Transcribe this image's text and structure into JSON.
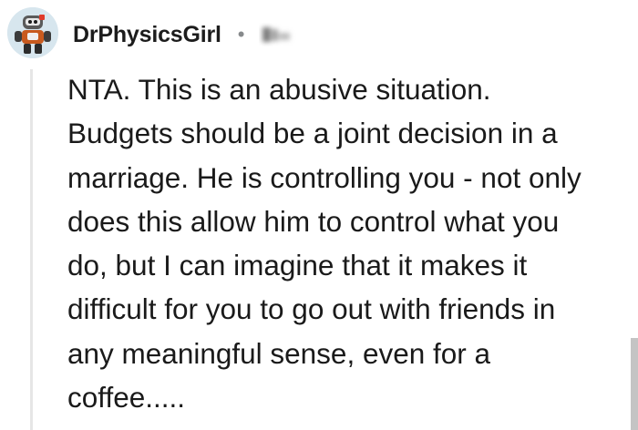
{
  "comment": {
    "author": "DrPhysicsGirl",
    "separator": "•",
    "timestamp_redacted": true,
    "lines": [
      "NTA. This is an abusive situation.",
      "Budgets should be a joint decision in a",
      "marriage. He is controlling you - not only",
      "does this allow him to control what you",
      "do, but I can imagine that it makes it",
      "difficult for you to go out with friends in",
      "any meaningful sense, even for a",
      "coffee....."
    ]
  },
  "colors": {
    "author_text": "#1c1c1c",
    "body_text": "#1a1a1a",
    "meta_gray": "#878a8c",
    "thread_line": "#e6e6e6",
    "avatar_bg": "#d7e6ee",
    "scrollbar": "#c4c4c4"
  },
  "icons": {
    "avatar": "robot-avatar-icon"
  }
}
